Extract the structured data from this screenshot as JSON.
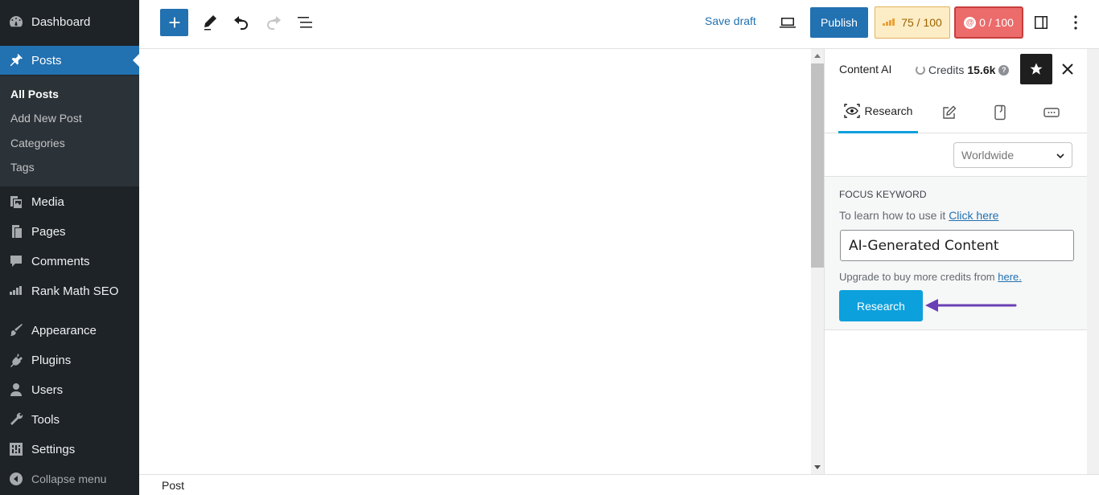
{
  "admin_menu": {
    "items": [
      {
        "label": "Dashboard",
        "icon": "dashboard-icon"
      },
      {
        "label": "Posts",
        "icon": "pin-icon",
        "current": true
      },
      {
        "label": "Media",
        "icon": "media-icon"
      },
      {
        "label": "Pages",
        "icon": "pages-icon"
      },
      {
        "label": "Comments",
        "icon": "comments-icon"
      },
      {
        "label": "Rank Math SEO",
        "icon": "rank-math-icon"
      },
      {
        "label": "Appearance",
        "icon": "appearance-icon"
      },
      {
        "label": "Plugins",
        "icon": "plugins-icon"
      },
      {
        "label": "Users",
        "icon": "users-icon"
      },
      {
        "label": "Tools",
        "icon": "tools-icon"
      },
      {
        "label": "Settings",
        "icon": "settings-icon"
      }
    ],
    "submenu": [
      "All Posts",
      "Add New Post",
      "Categories",
      "Tags"
    ],
    "collapse_label": "Collapse menu"
  },
  "toolbar": {
    "save_draft": "Save draft",
    "publish": "Publish",
    "seo_score": "75 / 100",
    "content_ai_score": "0 / 100"
  },
  "footer": {
    "breadcrumb": "Post"
  },
  "panel": {
    "title": "Content AI",
    "credits_label": "Credits",
    "credits_value": "15.6k",
    "help_glyph": "?",
    "tabs": [
      {
        "label": "Research",
        "icon": "eye-scan-icon",
        "active": true
      },
      {
        "label": "",
        "icon": "edit-icon"
      },
      {
        "label": "",
        "icon": "phone-icon"
      },
      {
        "label": "",
        "icon": "chat-icon"
      }
    ],
    "region": "Worldwide",
    "focus_keyword": {
      "heading": "FOCUS KEYWORD",
      "help_text": "To learn how to use it",
      "help_link": "Click here",
      "value": "AI-Generated Content",
      "upgrade_text": "Upgrade to buy more credits from",
      "upgrade_link": "here.",
      "button": "Research"
    }
  },
  "colors": {
    "admin_bg": "#1d2327",
    "accent": "#2271b1",
    "content_ai_blue": "#0ca0dc",
    "annotation_arrow": "#6b3fb5"
  }
}
